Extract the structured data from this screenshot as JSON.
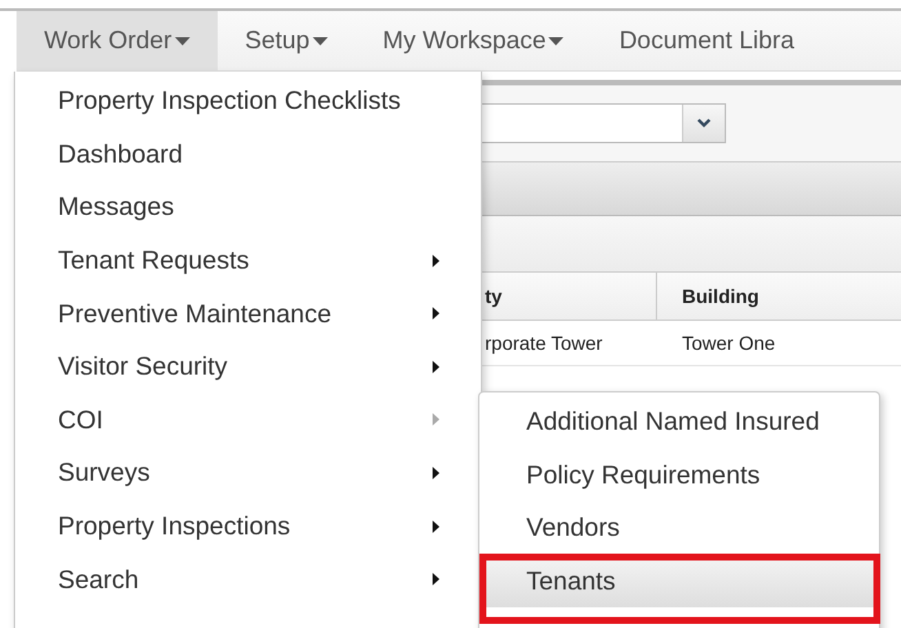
{
  "nav": {
    "items": [
      {
        "label": "Work Order",
        "caret": true,
        "selected": true
      },
      {
        "label": "Setup",
        "caret": true,
        "selected": false
      },
      {
        "label": "My Workspace",
        "caret": true,
        "selected": false
      },
      {
        "label": "Document Libra",
        "caret": false,
        "selected": false
      }
    ]
  },
  "page": {
    "table": {
      "columns": [
        "ty",
        "Building"
      ],
      "rows": [
        [
          "rporate Tower",
          "Tower One"
        ]
      ]
    }
  },
  "menu": {
    "items": [
      {
        "label": "Property Inspection Checklists",
        "has_submenu": false
      },
      {
        "label": "Dashboard",
        "has_submenu": false
      },
      {
        "label": "Messages",
        "has_submenu": false
      },
      {
        "label": "Tenant Requests",
        "has_submenu": true,
        "expanded": false
      },
      {
        "label": "Preventive Maintenance",
        "has_submenu": true,
        "expanded": false
      },
      {
        "label": "Visitor Security",
        "has_submenu": true,
        "expanded": false
      },
      {
        "label": "COI",
        "has_submenu": true,
        "expanded": true
      },
      {
        "label": "Surveys",
        "has_submenu": true,
        "expanded": false
      },
      {
        "label": "Property Inspections",
        "has_submenu": true,
        "expanded": false
      },
      {
        "label": "Search",
        "has_submenu": true,
        "expanded": false
      }
    ]
  },
  "submenu": {
    "items": [
      {
        "label": "Additional Named Insured",
        "selected": false,
        "annotated": false
      },
      {
        "label": "Policy Requirements",
        "selected": false,
        "annotated": false
      },
      {
        "label": "Vendors",
        "selected": false,
        "annotated": false
      },
      {
        "label": "Tenants",
        "selected": true,
        "annotated": true
      }
    ]
  }
}
